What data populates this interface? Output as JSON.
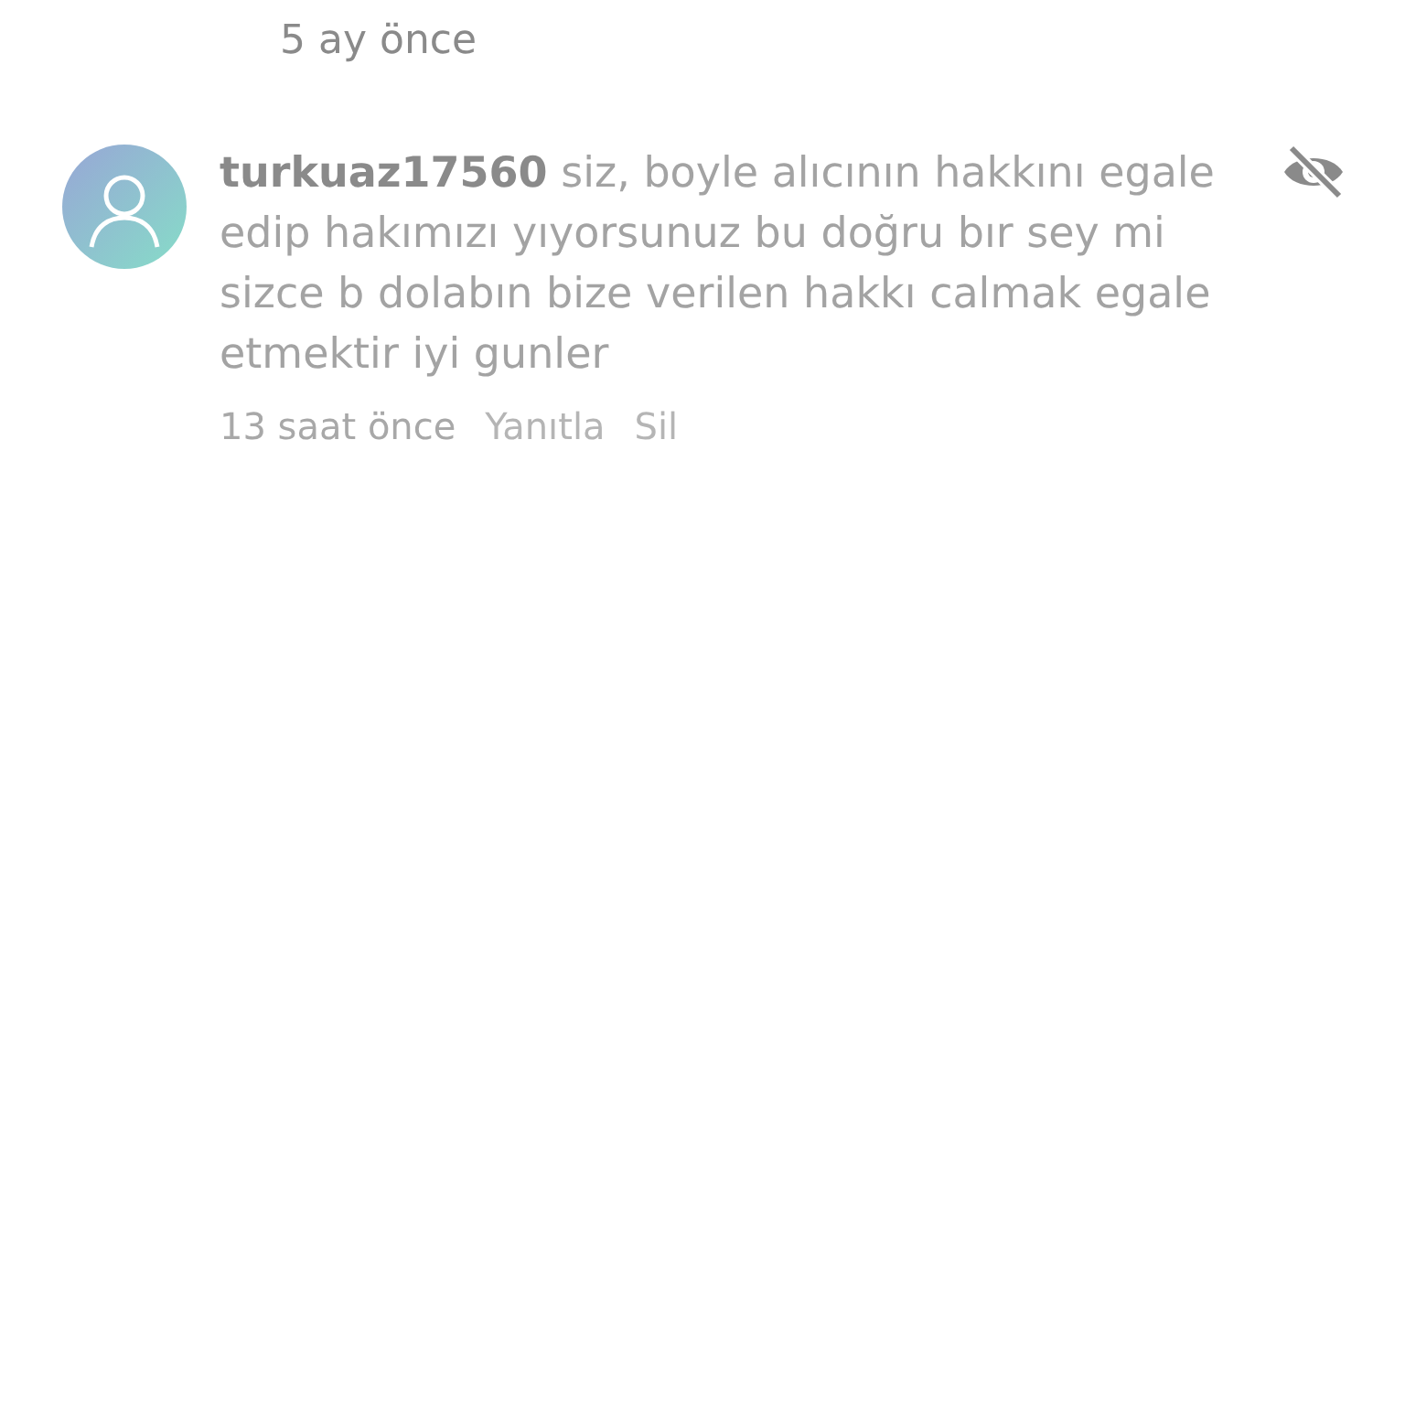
{
  "previous_comment": {
    "time": "5 ay önce"
  },
  "comment": {
    "text": "**turkuaz17560** siz, boyle alıcının hakkını egale edip hakımızı yıyorsunuz bu doğru bır sey mi sizce b dolabın bize verilen hakkı calmak egale etmektir iyi gunler",
    "hidden": true,
    "time": "13 saat önce",
    "actions": [
      "Yanıtla",
      "Sil"
    ]
  }
}
